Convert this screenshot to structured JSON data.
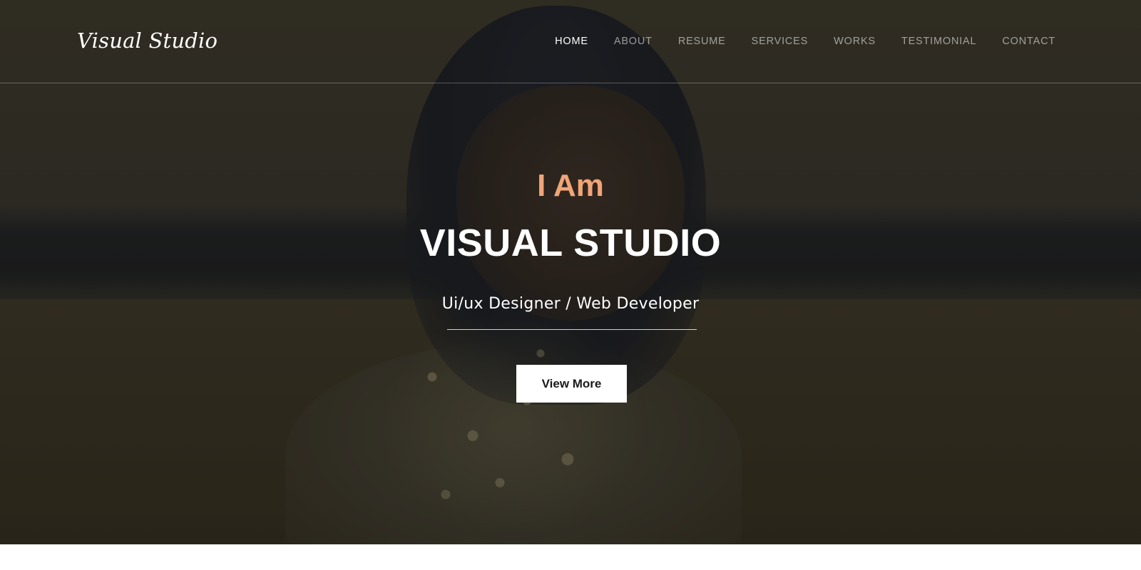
{
  "header": {
    "logo": "Visual Studio",
    "nav": [
      {
        "label": "HOME",
        "active": true
      },
      {
        "label": "ABOUT",
        "active": false
      },
      {
        "label": "RESUME",
        "active": false
      },
      {
        "label": "SERVICES",
        "active": false
      },
      {
        "label": "WORKS",
        "active": false
      },
      {
        "label": "TESTIMONIAL",
        "active": false
      },
      {
        "label": "CONTACT",
        "active": false
      }
    ]
  },
  "hero": {
    "intro": "I Am",
    "headline": "VISUAL STUDIO",
    "tagline": "Ui/ux Designer / Web Developer",
    "cta_label": "View More"
  },
  "colors": {
    "accent": "#f0a578",
    "text": "#ffffff",
    "nav_inactive": "rgba(255,255,255,0.55)",
    "button_bg": "#ffffff",
    "button_text": "#1a1a1a"
  }
}
